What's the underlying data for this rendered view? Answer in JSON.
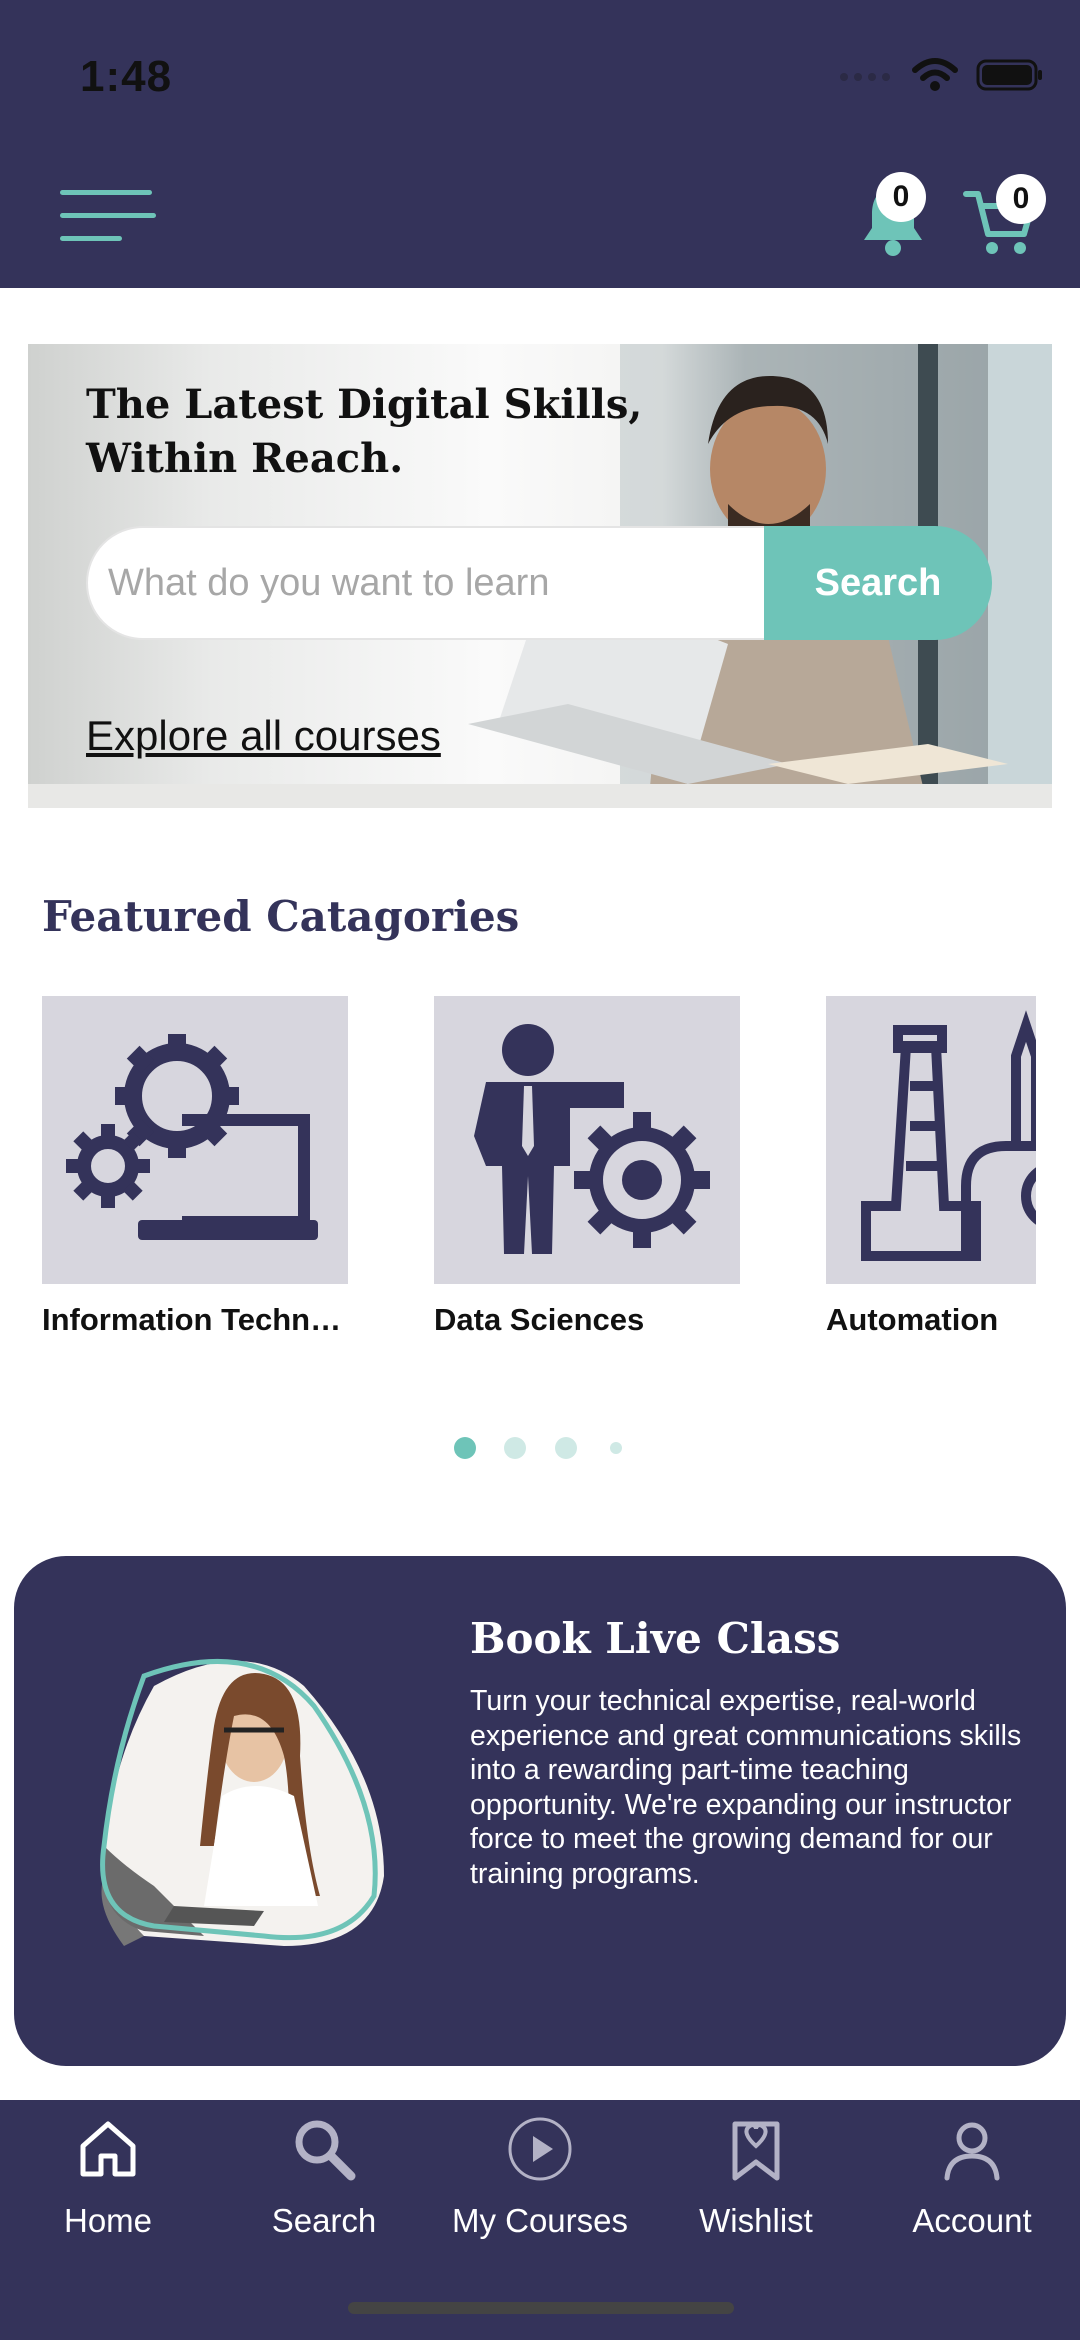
{
  "status_bar": {
    "time": "1:48"
  },
  "header": {
    "notifications_count": "0",
    "cart_count": "0"
  },
  "hero": {
    "title": "The Latest Digital Skills, Within Reach.",
    "search_placeholder": "What do you want to learn",
    "search_button": "Search",
    "explore_link": "Explore all courses"
  },
  "featured": {
    "title": "Featured Catagories",
    "categories": [
      {
        "label": "Information Technology",
        "icon": "laptop-gears-icon"
      },
      {
        "label": "Data Sciences",
        "icon": "person-gear-icon"
      },
      {
        "label": "Automation",
        "icon": "automation-tower-icon"
      }
    ],
    "pager": {
      "pages": 4,
      "active_index": 0
    }
  },
  "live_class": {
    "title": "Book Live Class",
    "description": "Turn your technical expertise, real-world experience and great communications skills into a rewarding part-time teaching opportunity. We're expanding our instructor force to meet the growing demand for our training programs."
  },
  "tabbar": {
    "items": [
      {
        "label": "Home",
        "icon": "home-icon"
      },
      {
        "label": "Search",
        "icon": "search-icon"
      },
      {
        "label": "My Courses",
        "icon": "play-circle-icon"
      },
      {
        "label": "Wishlist",
        "icon": "bookmark-heart-icon"
      },
      {
        "label": "Account",
        "icon": "user-icon"
      }
    ]
  },
  "colors": {
    "brand_navy": "#34335a",
    "accent_teal": "#6ec4b8",
    "category_bg": "#d7d6de"
  }
}
